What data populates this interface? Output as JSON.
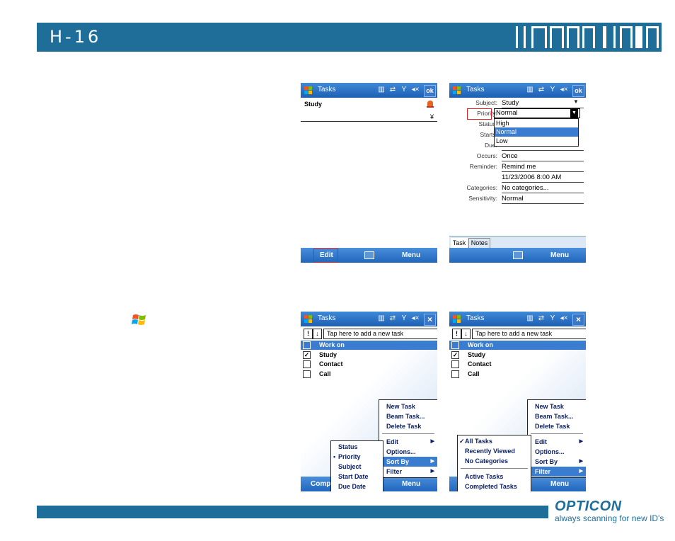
{
  "header": {
    "title": "H-16"
  },
  "footer": {
    "logo": "OPTICON",
    "tagline": "always scanning for new ID's"
  },
  "colors": {
    "brand": "#1f6e9a",
    "titlebar": "#2a6fc4",
    "highlight": "#3a7dd0",
    "alert": "#e02020"
  },
  "screen1": {
    "app_title": "Tasks",
    "ok": "ok",
    "task_subject": "Study",
    "expand_glyph": "¥",
    "menu_left": "Edit",
    "menu_right": "Menu"
  },
  "screen2": {
    "app_title": "Tasks",
    "ok": "ok",
    "fields": [
      {
        "label": "Subject:",
        "value": "Study"
      },
      {
        "label": "Priority:",
        "value": "Normal"
      },
      {
        "label": "Status:",
        "value": ""
      },
      {
        "label": "Starts:",
        "value": ""
      },
      {
        "label": "Due:",
        "value": ""
      },
      {
        "label": "Occurs:",
        "value": "Once"
      },
      {
        "label": "Reminder:",
        "value": "Remind me"
      },
      {
        "label": "",
        "value": "11/23/2006  8:00 AM"
      },
      {
        "label": "Categories:",
        "value": "No categories..."
      },
      {
        "label": "Sensitivity:",
        "value": "Normal"
      }
    ],
    "priority_options": [
      "High",
      "Normal",
      "Low"
    ],
    "tabs": [
      "Task",
      "Notes"
    ],
    "menu_right": "Menu"
  },
  "screen3": {
    "app_title": "Tasks",
    "close": "×",
    "add_task_placeholder": "Tap here to add a new task",
    "tasks": [
      {
        "name": "Work on",
        "checked": false
      },
      {
        "name": "Study",
        "checked": true
      },
      {
        "name": "Contact",
        "checked": false
      },
      {
        "name": "Call",
        "checked": false
      }
    ],
    "menu_items": [
      "New Task",
      "Beam Task...",
      "Delete Task",
      "Edit",
      "Options...",
      "Sort By",
      "Filter"
    ],
    "submenu": [
      "Status",
      "Priority",
      "Subject",
      "Start Date",
      "Due Date"
    ],
    "submenu_checked": "Priority",
    "menu_left": "Comp",
    "menu_right": "Menu"
  },
  "screen4": {
    "app_title": "Tasks",
    "close": "×",
    "add_task_placeholder": "Tap here to add a new task",
    "tasks": [
      {
        "name": "Work on",
        "checked": false
      },
      {
        "name": "Study",
        "checked": true
      },
      {
        "name": "Contact",
        "checked": false
      },
      {
        "name": "Call",
        "checked": false
      }
    ],
    "menu_items": [
      "New Task",
      "Beam Task...",
      "Delete Task",
      "Edit",
      "Options...",
      "Sort By",
      "Filter"
    ],
    "submenu": [
      "All Tasks",
      "Recently Viewed",
      "No Categories",
      "Active Tasks",
      "Completed Tasks"
    ],
    "submenu_checked": "All Tasks",
    "menu_right": "Menu"
  }
}
